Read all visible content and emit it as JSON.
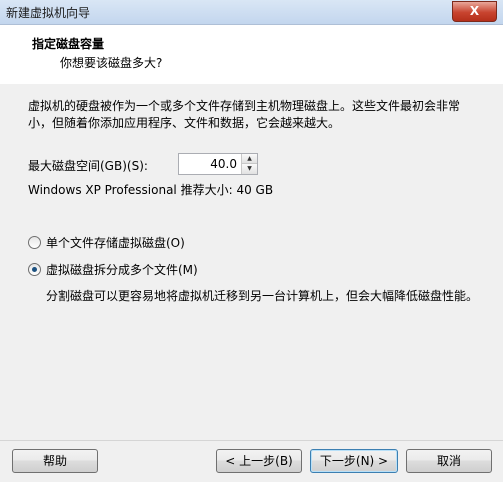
{
  "window": {
    "title": "新建虚拟机向导",
    "close_label": "X"
  },
  "header": {
    "title": "指定磁盘容量",
    "subtitle": "你想要该磁盘多大?"
  },
  "description": "虚拟机的硬盘被作为一个或多个文件存储到主机物理磁盘上。这些文件最初会非常小，但随着你添加应用程序、文件和数据，它会越来越大。",
  "disk_size": {
    "label": "最大磁盘空间(GB)(S):",
    "value": "40.0",
    "recommend": "Windows XP Professional 推荐大小: 40 GB"
  },
  "storage_options": [
    {
      "label": "单个文件存储虚拟磁盘(O)",
      "checked": false
    },
    {
      "label": "虚拟磁盘拆分成多个文件(M)",
      "checked": true
    }
  ],
  "storage_note": "分割磁盘可以更容易地将虚拟机迁移到另一台计算机上，但会大幅降低磁盘性能。",
  "buttons": {
    "help": "帮助",
    "back": "< 上一步(B)",
    "next": "下一步(N) >",
    "cancel": "取消"
  }
}
